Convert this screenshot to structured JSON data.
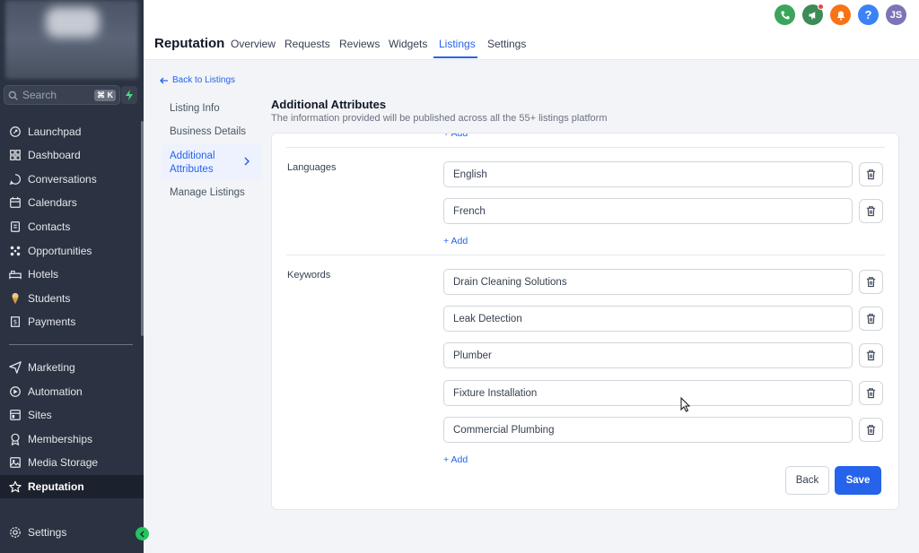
{
  "sidebar": {
    "search_placeholder": "Search",
    "search_shortcut": "⌘ K",
    "items": [
      {
        "label": "Launchpad",
        "icon": "rocket-icon"
      },
      {
        "label": "Dashboard",
        "icon": "dashboard-icon"
      },
      {
        "label": "Conversations",
        "icon": "chat-icon"
      },
      {
        "label": "Calendars",
        "icon": "calendar-icon"
      },
      {
        "label": "Contacts",
        "icon": "contacts-icon"
      },
      {
        "label": "Opportunities",
        "icon": "opportunities-icon"
      },
      {
        "label": "Hotels",
        "icon": "bed-icon"
      },
      {
        "label": "Students",
        "icon": "ice-cream-icon"
      },
      {
        "label": "Payments",
        "icon": "receipt-icon"
      },
      {
        "label": "Marketing",
        "icon": "send-icon"
      },
      {
        "label": "Automation",
        "icon": "automation-icon"
      },
      {
        "label": "Sites",
        "icon": "sites-icon"
      },
      {
        "label": "Memberships",
        "icon": "badge-icon"
      },
      {
        "label": "Media Storage",
        "icon": "image-icon"
      },
      {
        "label": "Reputation",
        "icon": "star-icon"
      },
      {
        "label": "Settings",
        "icon": "gear-icon"
      }
    ]
  },
  "header": {
    "title": "Reputation",
    "tabs": [
      "Overview",
      "Requests",
      "Reviews",
      "Widgets",
      "Listings",
      "Settings"
    ],
    "active_tab": "Listings",
    "avatar_initials": "JS"
  },
  "subnav": {
    "back_label": "Back to Listings",
    "items": [
      "Listing Info",
      "Business Details",
      "Additional\nAttributes",
      "Manage Listings"
    ]
  },
  "main": {
    "title": "Additional Attributes",
    "subtitle": "The information provided will be published across all the 55+ listings platform",
    "add_label": "+ Add",
    "languages": {
      "label": "Languages",
      "values": [
        "English",
        "French"
      ]
    },
    "keywords": {
      "label": "Keywords",
      "values": [
        "Drain Cleaning Solutions",
        "Leak Detection",
        "Plumber",
        "Fixture Installation",
        "Commercial Plumbing"
      ]
    },
    "back_button": "Back",
    "save_button": "Save"
  },
  "colors": {
    "accent": "#2563eb",
    "sidebar_bg": "#2b3342",
    "phone": "#3ba55d",
    "megaphone": "#3d8b56",
    "bell": "#f97316",
    "help": "#3b82f6",
    "avatar": "#7b75b8"
  }
}
